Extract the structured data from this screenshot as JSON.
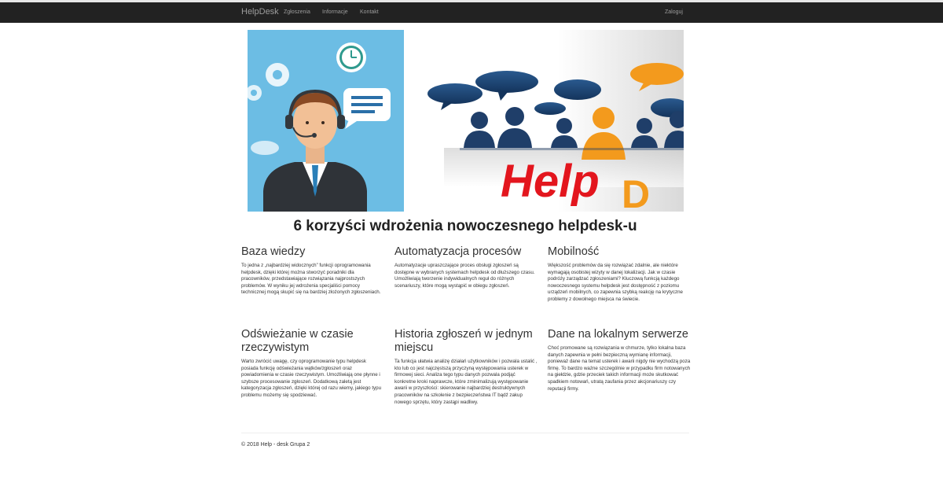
{
  "nav": {
    "brand": "HelpDesk",
    "links": [
      "Zgłoszenia",
      "Informacje",
      "Kontakt"
    ],
    "login": "Zaloguj"
  },
  "hero": {
    "logo_text": "Help",
    "logo_text_2": "D",
    "colors": {
      "left_bg": "#6cbde4",
      "red": "#e3161e",
      "orange": "#f39a1d",
      "navy": "#1f3e69"
    }
  },
  "headline": "6 korzyści wdrożenia nowoczesnego helpdesk-u",
  "features": [
    {
      "title": "Baza wiedzy",
      "text": "To jedna z „najbardziej widocznych” funkcji oprogramowania helpdesk, dzięki której można stworzyć poradniki dla pracowników, przedstawiające rozwiązania najprostszych problemów. W wyniku jej wdrożenia specjaliści pomocy technicznej mogą skupić się na bardziej złożonych zgłoszeniach."
    },
    {
      "title": "Automatyzacja procesów",
      "text": "Automatyzacje upraszczające proces obsługi zgłoszeń są dostępne w wybranych systemach helpdesk od dłuższego czasu. Umożliwiają tworzenie indywidualnych reguł do różnych scenariuszy, które mogą wystąpić w obiegu zgłoszeń."
    },
    {
      "title": "Mobilność",
      "text": "Większość problemów da się rozwiązać zdalnie, ale niektóre wymagają osobistej wizyty w danej lokalizacji. Jak w czasie podróży zarządzać zgłoszeniami? Kluczową funkcją każdego nowoczesnego systemu helpdesk jest dostępność z poziomu urządzeń mobilnych, co zapewnia szybką reakcję na krytyczne problemy z dowolnego miejsca na świecie."
    },
    {
      "title": "Odświeżanie w czasie rzeczywistym",
      "text": "Warto zwrócić uwagę, czy oprogramowanie typu helpdesk posiada funkcję odświeżania wątków/zgłoszeń oraz powiadomienia w czasie rzeczywistym. Umożliwiają one płynne i szybsze procesowanie zgłoszeń. Dodatkową zaletą jest kategoryzacja zgłoszeń, dzięki której od razu wiemy, jakiego typu problemu możemy się spodziewać."
    },
    {
      "title": "Historia zgłoszeń w jednym miejscu",
      "text": "Ta funkcja ułatwia analizę działań użytkowników i pozwala ustalić , kto lub co jest najczęstszą przyczyną występowania usterek w firmowej sieci. Analiza tego typu danych pozwala podjąć konkretne kroki naprawcze, które zminimalizują występowanie awarii w przyszłości: skierowanie najbardziej destruktywnych pracowników na szkolenie z bezpieczeństwa IT bądź zakup nowego sprzętu, który zastąpi wadliwy."
    },
    {
      "title": "Dane na lokalnym serwerze",
      "text": "Choć promowane są rozwiązania w chmurze, tylko lokalna baza danych zapewnia w pełni bezpieczną wymianę informacji, ponieważ dane na temat usterek i awarii nigdy nie wychodzą poza firmę. To bardzo ważne szczególnie w przypadku firm notowanych na giełdzie, gdzie przeciek takich informacji może skutkować spadkiem notowań, utratą zaufania przez akcjonariuszy czy reputacji firmy."
    }
  ],
  "footer": "© 2018 Help - desk Grupa 2"
}
